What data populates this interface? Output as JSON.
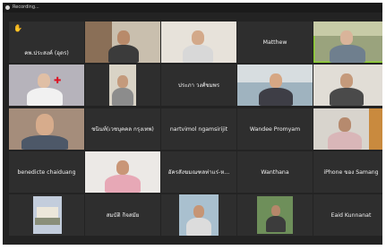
{
  "recording_label": "Recording...",
  "participants": {
    "p1": {
      "name": "คพ.ประสงค์ (อุดร)",
      "hand_icon": "raised-hand-icon"
    },
    "p2": {
      "name": ""
    },
    "p3": {
      "name": ""
    },
    "p4": {
      "name": "Matthew"
    },
    "p5": {
      "name": ""
    },
    "p6": {
      "name": ""
    },
    "p7": {
      "name": ""
    },
    "p8": {
      "name": "ประภา วงศ์ชมพร"
    },
    "p9": {
      "name": ""
    },
    "p10": {
      "name": ""
    },
    "p11": {
      "name": ""
    },
    "p12": {
      "name": "ชนินท์(เวชบุคคล กรุงเทพ)"
    },
    "p13": {
      "name": "nartvimol ngamsirijit"
    },
    "p14": {
      "name": "Wandee Promyam"
    },
    "p15": {
      "name": ""
    },
    "p16": {
      "name": "benedicte chaiduang"
    },
    "p17": {
      "name": ""
    },
    "p18": {
      "name": "อัครสังฆมณฑลท่าแร่-ห..."
    },
    "p19": {
      "name": "Wanthana"
    },
    "p20": {
      "name": "iPhone ของ Samang"
    },
    "p21": {
      "name": ""
    },
    "p22": {
      "name": "สมบัติ กิจสมัย"
    },
    "p23": {
      "name": ""
    },
    "p24": {
      "name": ""
    },
    "p25": {
      "name": "Eaid Kunnanat"
    }
  },
  "colors": {
    "tile_bg": "#2e2e2e",
    "speaker_border": "#8cd12f",
    "screen_bg": "#232323"
  }
}
